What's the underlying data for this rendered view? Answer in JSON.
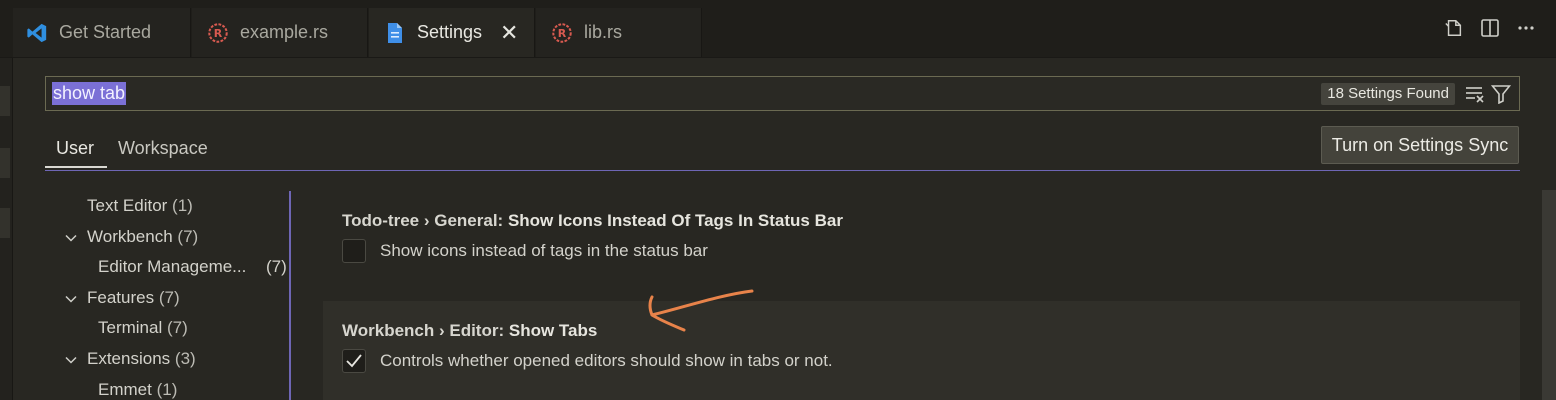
{
  "tabs": [
    {
      "label": "Get Started",
      "icon": "vscode-logo-icon"
    },
    {
      "label": "example.rs",
      "icon": "rust-file-icon"
    },
    {
      "label": "Settings",
      "icon": "settings-file-icon"
    },
    {
      "label": "lib.rs",
      "icon": "rust-file-icon"
    }
  ],
  "search": {
    "query": "show tab",
    "results_count": "18 Settings Found"
  },
  "scopes": {
    "user": "User",
    "workspace": "Workspace"
  },
  "sync_button": "Turn on Settings Sync",
  "toc": [
    {
      "label": "Text Editor",
      "count": "(1)"
    },
    {
      "label": "Workbench",
      "count": "(7)"
    },
    {
      "label": "Editor Manageme...",
      "count": "(7)"
    },
    {
      "label": "Features",
      "count": "(7)"
    },
    {
      "label": "Terminal",
      "count": "(7)"
    },
    {
      "label": "Extensions",
      "count": "(3)"
    },
    {
      "label": "Emmet",
      "count": "(1)"
    }
  ],
  "settings": [
    {
      "category": "Todo-tree › General: ",
      "name": "Show Icons Instead Of Tags In Status Bar",
      "description": "Show icons instead of tags in the status bar",
      "checked": false
    },
    {
      "category": "Workbench › Editor: ",
      "name": "Show Tabs",
      "description": "Controls whether opened editors should show in tabs or not.",
      "checked": true
    }
  ],
  "colors": {
    "accent": "#7b70d6",
    "annotation": "#e8834a",
    "rust_icon": "#d85a50",
    "vscode_blue": "#2f8fe0"
  }
}
